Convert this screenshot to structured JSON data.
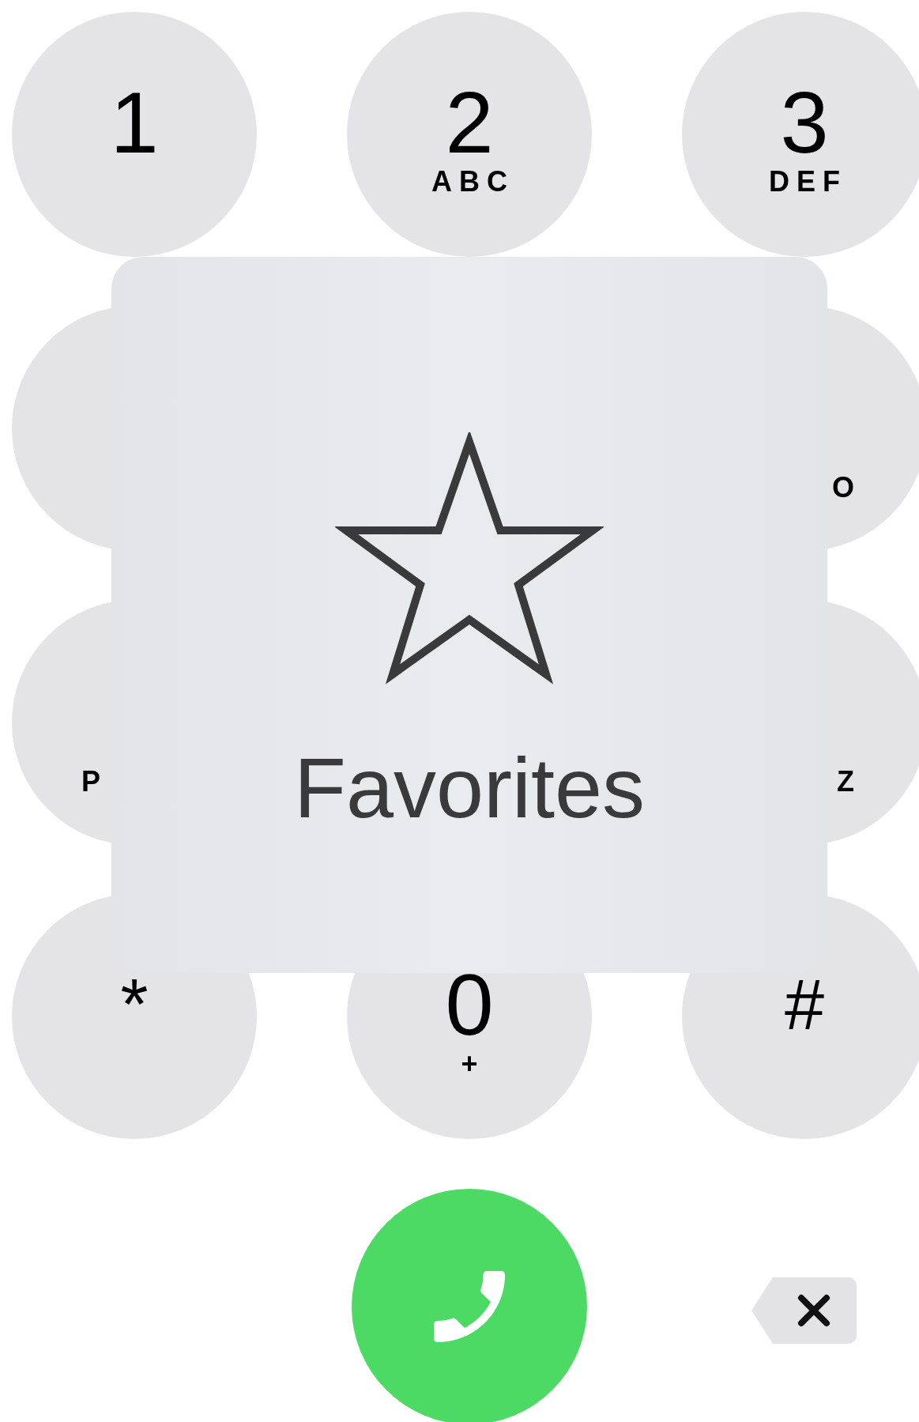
{
  "keypad": {
    "rows": [
      [
        {
          "kind": "full",
          "digit": "1"
        },
        {
          "kind": "full",
          "digit": "2",
          "letters": "ABC"
        },
        {
          "kind": "full",
          "digit": "3",
          "letters": "DEF"
        }
      ],
      [
        {
          "kind": "covered-left"
        },
        {
          "kind": "hidden"
        },
        {
          "kind": "covered-right",
          "letters": "O"
        }
      ],
      [
        {
          "kind": "covered-left",
          "letters": "P"
        },
        {
          "kind": "hidden"
        },
        {
          "kind": "covered-right",
          "letters": "Z"
        }
      ],
      [
        {
          "kind": "full",
          "digit": "*"
        },
        {
          "kind": "full",
          "digit": "0",
          "letters": "+"
        },
        {
          "kind": "full",
          "digit": "#"
        }
      ]
    ]
  },
  "overlay": {
    "label": "Favorites"
  }
}
